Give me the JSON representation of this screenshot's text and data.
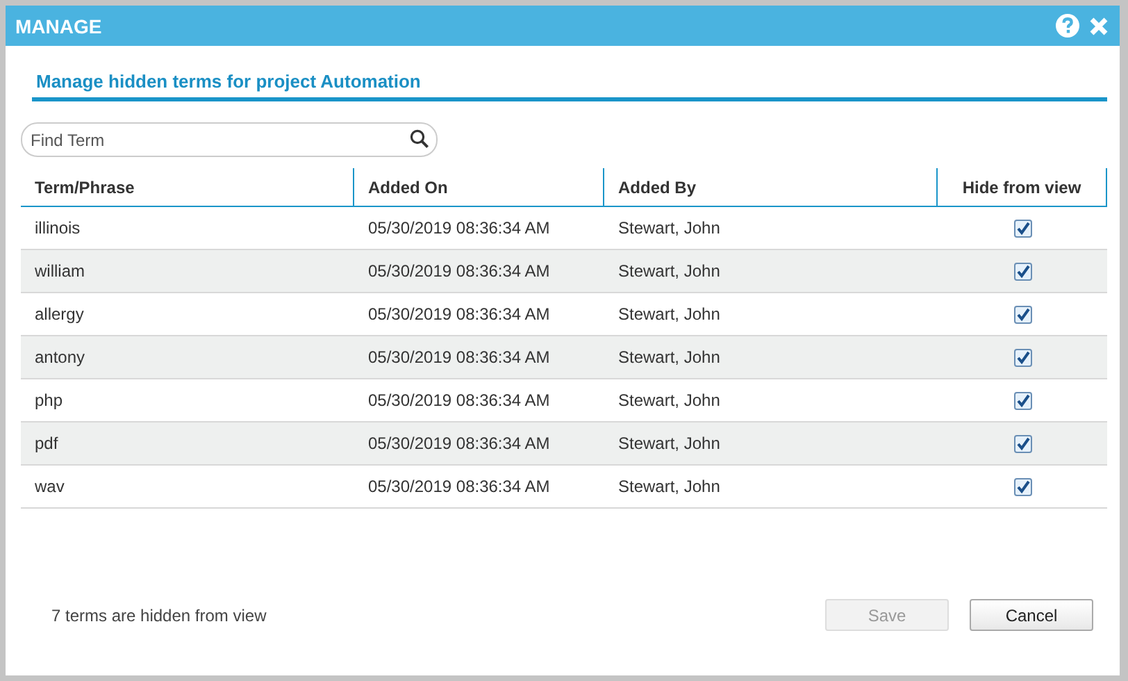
{
  "window": {
    "title": "MANAGE"
  },
  "heading": "Manage hidden terms for project Automation",
  "search": {
    "placeholder": "Find Term"
  },
  "table": {
    "columns": [
      "Term/Phrase",
      "Added On",
      "Added By",
      "Hide from view"
    ],
    "rows": [
      {
        "term": "illinois",
        "added_on": "05/30/2019 08:36:34 AM",
        "added_by": "Stewart, John",
        "hidden": true
      },
      {
        "term": "william",
        "added_on": "05/30/2019 08:36:34 AM",
        "added_by": "Stewart, John",
        "hidden": true
      },
      {
        "term": "allergy",
        "added_on": "05/30/2019 08:36:34 AM",
        "added_by": "Stewart, John",
        "hidden": true
      },
      {
        "term": "antony",
        "added_on": "05/30/2019 08:36:34 AM",
        "added_by": "Stewart, John",
        "hidden": true
      },
      {
        "term": "php",
        "added_on": "05/30/2019 08:36:34 AM",
        "added_by": "Stewart, John",
        "hidden": true
      },
      {
        "term": "pdf",
        "added_on": "05/30/2019 08:36:34 AM",
        "added_by": "Stewart, John",
        "hidden": true
      },
      {
        "term": "wav",
        "added_on": "05/30/2019 08:36:34 AM",
        "added_by": "Stewart, John",
        "hidden": true
      }
    ]
  },
  "footer": {
    "status": "7 terms are hidden from view",
    "buttons": [
      {
        "label": "Save",
        "disabled": true
      },
      {
        "label": "Cancel",
        "disabled": false
      }
    ]
  }
}
